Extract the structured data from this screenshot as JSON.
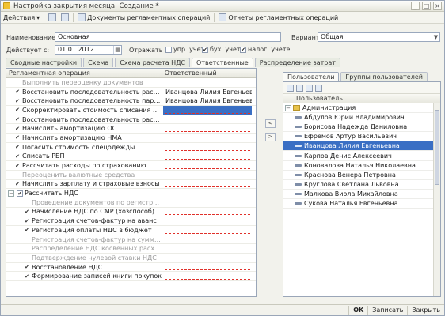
{
  "window": {
    "title": "Настройка закрытия месяца: Создание *"
  },
  "toolbar": {
    "actions": "Действия",
    "docs": "Документы регламентных операций",
    "reports": "Отчеты регламентных операций"
  },
  "form": {
    "name_label": "Наименование:",
    "name_value": "Основная",
    "variant_label": "Вариант:",
    "variant_value": "Общая",
    "date_label": "Действует с:",
    "date_value": "01.01.2012",
    "reflect_label": "Отражать в:",
    "upr_label": "упр. учете",
    "buh_label": "бух. учете",
    "nal_label": "налог. учете"
  },
  "tabs": [
    "Сводные настройки",
    "Схема",
    "Схема расчета НДС",
    "Ответственные",
    "Распределение затрат"
  ],
  "grid": {
    "col_operation": "Регламентная операция",
    "col_responsible": "Ответственный",
    "rows": [
      {
        "text": "Выполнить переоценку документов",
        "resp": "",
        "check": "",
        "dis": true,
        "level": 1
      },
      {
        "text": "Восстановить последовательность расчетов по...",
        "resp": "Иванцова Лилия Евгеньевна",
        "check": "✔",
        "dis": false,
        "level": 1
      },
      {
        "text": "Восстановить последовательность партионног...",
        "resp": "Иванцова Лилия Евгеньевна",
        "check": "✔",
        "dis": false,
        "level": 1
      },
      {
        "text": "Скорректировать стоимость списания МПЗ",
        "resp": "",
        "check": "✔",
        "dis": false,
        "level": 1,
        "sel": true
      },
      {
        "text": "Восстановить последовательность расчетов по...",
        "resp": "",
        "check": "✔",
        "dis": false,
        "level": 1
      },
      {
        "text": "Начислить амортизацию ОС",
        "resp": "",
        "check": "✔",
        "dis": false,
        "level": 1
      },
      {
        "text": "Начислить амортизацию НМА",
        "resp": "",
        "check": "✔",
        "dis": false,
        "level": 1
      },
      {
        "text": "Погасить стоимость спецодежды",
        "resp": "",
        "check": "✔",
        "dis": false,
        "level": 1
      },
      {
        "text": "Списать РБП",
        "resp": "",
        "check": "✔",
        "dis": false,
        "level": 1
      },
      {
        "text": "Рассчитать расходы по страхованию",
        "resp": "",
        "check": "✔",
        "dis": false,
        "level": 1
      },
      {
        "text": "Переоценить валютные средства",
        "resp": "",
        "check": "",
        "dis": true,
        "level": 1
      },
      {
        "text": "Начислить зарплату и страховые взносы",
        "resp": "",
        "check": "✔",
        "dis": false,
        "level": 1
      },
      {
        "text": "Рассчитать НДС",
        "resp": "",
        "check": "",
        "dis": false,
        "level": 0,
        "group": true
      },
      {
        "text": "Проведение документов по регистрам НДС",
        "resp": "",
        "check": "",
        "dis": true,
        "level": 2
      },
      {
        "text": "Начисление НДС по СМР (хозспособ)",
        "resp": "",
        "check": "✔",
        "dis": false,
        "level": 2
      },
      {
        "text": "Регистрация счетов-фактур на аванс",
        "resp": "",
        "check": "✔",
        "dis": false,
        "level": 2
      },
      {
        "text": "Регистрация оплаты НДС в бюджет",
        "resp": "",
        "check": "✔",
        "dis": false,
        "level": 2
      },
      {
        "text": "Регистрация счетов-фактур на суммовые р...",
        "resp": "",
        "check": "",
        "dis": true,
        "level": 2
      },
      {
        "text": "Распределение НДС косвенных расходов",
        "resp": "",
        "check": "",
        "dis": true,
        "level": 2
      },
      {
        "text": "Подтверждение нулевой ставки НДС",
        "resp": "",
        "check": "",
        "dis": true,
        "level": 2
      },
      {
        "text": "Восстановление НДС",
        "resp": "",
        "check": "✔",
        "dis": false,
        "level": 2
      },
      {
        "text": "Формирование записей книги покупок",
        "resp": "",
        "check": "✔",
        "dis": false,
        "level": 2
      }
    ]
  },
  "right": {
    "tab_users": "Пользователи",
    "tab_groups": "Группы пользователей",
    "col_user": "Пользователь",
    "admin": "Администрация",
    "users": [
      "Абдулов Юрий Владимирович",
      "Борисова Надежда Даниловна",
      "Ефремов Артур Васильевич",
      "Иванцова Лилия Евгеньевна",
      "Карпов Денис Алексеевич",
      "Коновалова Наталья Николаевна",
      "Краснова Венера Петровна",
      "Круглова Светлана Львовна",
      "Малкова Виола Михайловна",
      "Сукова Наталья Евгеньевна"
    ],
    "selected_index": 3
  },
  "status": {
    "ok": "OK",
    "save": "Записать",
    "close": "Закрыть"
  },
  "colors": {
    "accent": "#3a6fc4",
    "required": "#e0302a"
  }
}
